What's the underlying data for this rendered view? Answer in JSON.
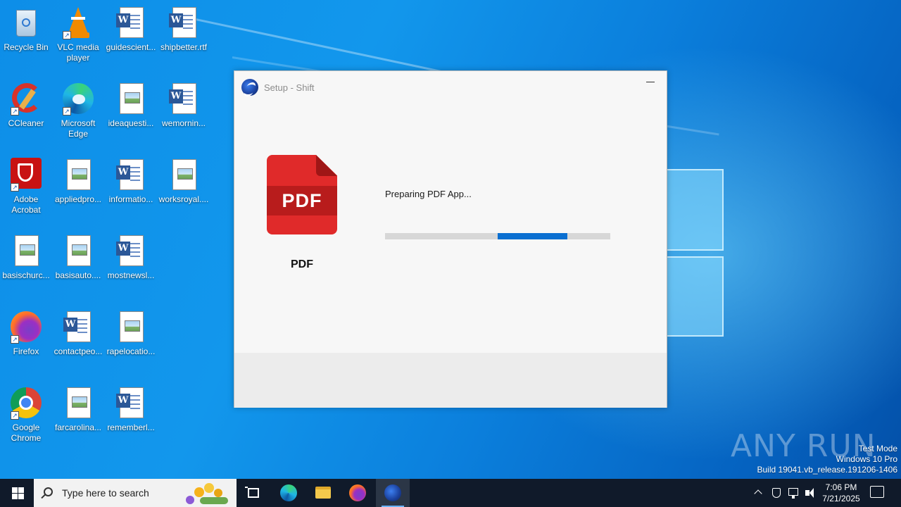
{
  "desktop": {
    "icons": [
      {
        "label": "Recycle Bin",
        "icon": "recycle-bin-icon"
      },
      {
        "label": "VLC media player",
        "icon": "vlc-icon"
      },
      {
        "label": "guidescient...",
        "icon": "word-doc-icon"
      },
      {
        "label": "shipbetter.rtf",
        "icon": "word-doc-icon"
      },
      {
        "label": "CCleaner",
        "icon": "ccleaner-icon"
      },
      {
        "label": "Microsoft Edge",
        "icon": "edge-icon"
      },
      {
        "label": "ideaquesti...",
        "icon": "image-file-icon"
      },
      {
        "label": "wemornin...",
        "icon": "word-doc-icon"
      },
      {
        "label": "Adobe Acrobat",
        "icon": "acrobat-icon"
      },
      {
        "label": "appliedpro...",
        "icon": "image-file-icon"
      },
      {
        "label": "informatio...",
        "icon": "word-doc-icon"
      },
      {
        "label": "worksroyal....",
        "icon": "image-file-icon"
      },
      {
        "label": "basischurc...",
        "icon": "image-file-icon"
      },
      {
        "label": "basisauto....",
        "icon": "image-file-icon"
      },
      {
        "label": "mostnewsl...",
        "icon": "word-doc-icon"
      },
      {
        "label": "Firefox",
        "icon": "firefox-icon"
      },
      {
        "label": "contactpeo...",
        "icon": "word-doc-icon"
      },
      {
        "label": "rapelocatio...",
        "icon": "image-file-icon"
      },
      {
        "label": "Google Chrome",
        "icon": "chrome-icon"
      },
      {
        "label": "farcarolina...",
        "icon": "image-file-icon"
      },
      {
        "label": "rememberl...",
        "icon": "word-doc-icon"
      }
    ]
  },
  "setup_window": {
    "title": "Setup - Shift",
    "product_label": "PDF",
    "product_badge": "PDF",
    "status": "Preparing PDF App...",
    "progress_start": 0.5,
    "progress_end": 0.81,
    "accent_color": "#0a6fd1"
  },
  "watermark": {
    "brand": "ANY RUN",
    "line1": "Test Mode",
    "line2": "Windows 10 Pro",
    "line3": "Build 19041.vb_release.191206-1406"
  },
  "taskbar": {
    "search_placeholder": "Type here to search",
    "time": "7:06 PM",
    "date": "7/21/2025"
  }
}
